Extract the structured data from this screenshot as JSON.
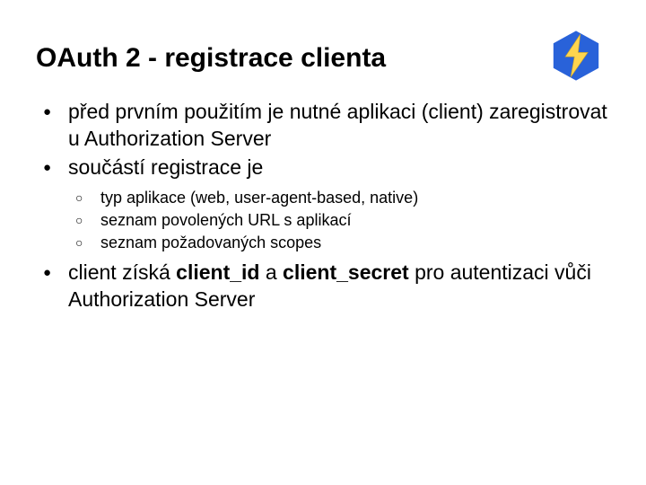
{
  "title": "OAuth 2 - registrace clienta",
  "bullets": {
    "b1": "před prvním použitím je nutné aplikaci (client) zaregistrovat u Authorization Server",
    "b2": "součástí registrace je",
    "sub1": "typ aplikace (web, user-agent-based, native)",
    "sub2": "seznam povolených URL s aplikací",
    "sub3": "seznam požadovaných scopes",
    "b3_pre": "client získá ",
    "b3_id": "client_id",
    "b3_mid": " a ",
    "b3_secret": "client_secret",
    "b3_post": " pro autentizaci vůči Authorization Server"
  }
}
